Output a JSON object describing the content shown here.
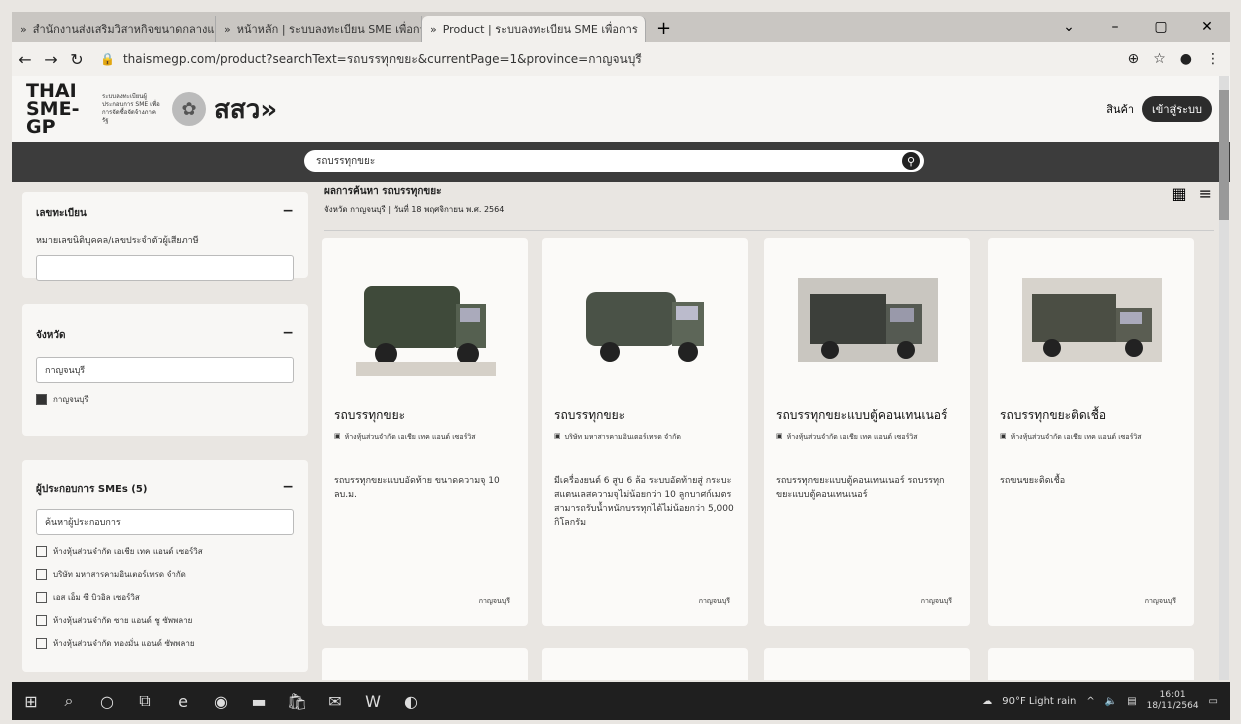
{
  "browser": {
    "tabs": [
      {
        "label": "สำนักงานส่งเสริมวิสาหกิจขนาดกลางและ"
      },
      {
        "label": "หน้าหลัก | ระบบลงทะเบียน SME เพื่อการ"
      },
      {
        "label": "Product | ระบบลงทะเบียน SME เพื่อการ"
      }
    ],
    "new_tab": "+",
    "url": "thaismegp.com/product?searchText=รถบรรทุกขยะ&currentPage=1&province=กาญจนบุรี"
  },
  "header": {
    "logo_main": "THAI SME-GP",
    "logo_sub": "ระบบลงทะเบียนผู้ประกอบการ SME เพื่อการจัดซื้อจัดจ้างภาครัฐ",
    "brand": "สสว»",
    "cart_label": "สินค้า",
    "login_label": "เข้าสู่ระบบ"
  },
  "search": {
    "value": "รถบรรทุกขยะ"
  },
  "filters": {
    "register": {
      "title": "เลขทะเบียน",
      "sub": "หมายเลขนิติบุคคล/เลขประจำตัวผู้เสียภาษี",
      "input": ""
    },
    "province": {
      "title": "จังหวัด",
      "input": "กาญจนบุรี",
      "checked": "กาญจนบุรี"
    },
    "sellers": {
      "title": "ผู้ประกอบการ SMEs (5)",
      "input": "ค้นหาผู้ประกอบการ",
      "items": [
        "ห้างหุ้นส่วนจำกัด เอเชีย เทค แอนด์ เซอร์วิส",
        "บริษัท มหาสารคามอินเตอร์เทรด จำกัด",
        "เอส เอ็ม ซี บิวอิล เซอร์วิส",
        "ห้างหุ้นส่วนจำกัด ซาย แอนด์ ชู ซัพพลาย",
        "ห้างหุ้นส่วนจำกัด ทองมั่น แอนด์ ซัพพลาย"
      ]
    }
  },
  "results": {
    "title": "ผลการค้นหา รถบรรทุกขยะ",
    "subtitle": "จังหวัด กาญจนบุรี | วันที่ 18 พฤศจิกายน พ.ศ. 2564"
  },
  "products": [
    {
      "title": "รถบรรทุกขยะ",
      "seller": "ห้างหุ้นส่วนจำกัด เอเชีย เทค แอนด์ เซอร์วิส",
      "desc": "รถบรรทุกขยะแบบอัดท้าย ขนาดความจุ 10 ลบ.ม.",
      "loc": "กาญจนบุรี"
    },
    {
      "title": "รถบรรทุกขยะ",
      "seller": "บริษัท มหาสารคามอินเตอร์เทรด จำกัด",
      "desc": "มีเครื่องยนต์ 6 สูบ 6 ล้อ ระบบอัดท้ายสู่ กระบะสแตนเลสความจุไม่น้อยกว่า 10 ลูกบาศก์เมตร สามารถรับน้ำหนักบรรทุกได้ไม่น้อยกว่า 5,000 กิโลกรัม",
      "loc": "กาญจนบุรี"
    },
    {
      "title": "รถบรรทุกขยะแบบตู้คอนเทนเนอร์",
      "seller": "ห้างหุ้นส่วนจำกัด เอเชีย เทค แอนด์ เซอร์วิส",
      "desc": "รถบรรทุกขยะแบบตู้คอนเทนเนอร์ รถบรรทุกขยะแบบตู้คอนเทนเนอร์",
      "loc": "กาญจนบุรี"
    },
    {
      "title": "รถบรรทุกขยะติดเชื้อ",
      "seller": "ห้างหุ้นส่วนจำกัด เอเชีย เทค แอนด์ เซอร์วิส",
      "desc": "รถขนขยะติดเชื้อ",
      "loc": "กาญจนบุรี"
    }
  ],
  "taskbar": {
    "weather": "90°F Light rain",
    "time": "16:01",
    "date": "18/11/2564"
  }
}
